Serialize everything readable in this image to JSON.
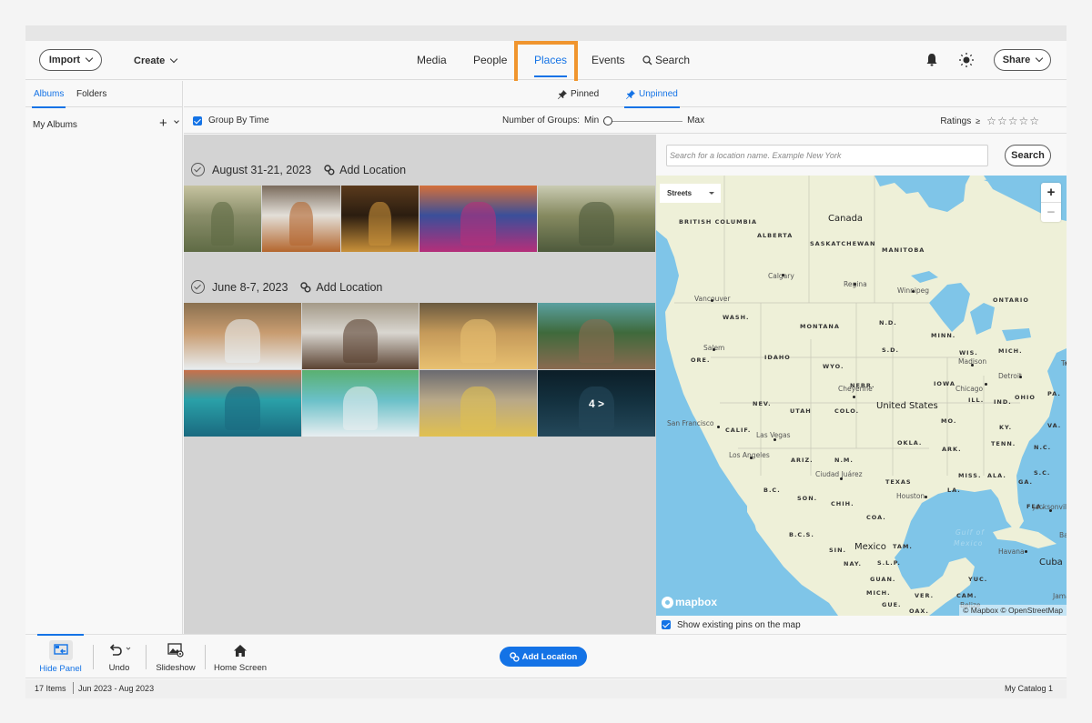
{
  "topbar": {
    "import_label": "Import",
    "create_label": "Create",
    "nav": [
      {
        "label": "Media",
        "active": false
      },
      {
        "label": "People",
        "active": false
      },
      {
        "label": "Places",
        "active": true
      },
      {
        "label": "Events",
        "active": false
      },
      {
        "label": "Search",
        "active": false
      }
    ],
    "share_label": "Share",
    "icons": [
      "bell-icon",
      "brightness-icon"
    ]
  },
  "sidebar": {
    "tabs": [
      {
        "label": "Albums",
        "active": true
      },
      {
        "label": "Folders",
        "active": false
      }
    ],
    "my_albums_label": "My Albums"
  },
  "subbar": {
    "tabs": [
      {
        "label": "Pinned",
        "active": false
      },
      {
        "label": "Unpinned",
        "active": true
      }
    ]
  },
  "filterbar": {
    "group_by_time_label": "Group By Time",
    "group_by_time_checked": true,
    "number_of_groups_label": "Number of Groups:",
    "min_label": "Min",
    "max_label": "Max",
    "groups_slider_value": 0,
    "ratings_label": "Ratings",
    "ratings_operator": "≥",
    "ratings_stars": 0,
    "ratings_max": 5
  },
  "groups": [
    {
      "date": "August 31-21, 2023",
      "add_location_label": "Add Location",
      "photos": [
        {
          "desc": "Hikers walking through a grassy valley",
          "colors": [
            "#8a8e6a",
            "#5f6b45",
            "#c6c3a0"
          ]
        },
        {
          "desc": "Person dancing on a couch in a living room",
          "colors": [
            "#e3dfd8",
            "#b4662e",
            "#7a6b5c"
          ]
        },
        {
          "desc": "Hand reaching toward string lights at night",
          "colors": [
            "#2b1d10",
            "#c9913a",
            "#5a3a1c"
          ]
        },
        {
          "desc": "Collage of people in neon colored lighting",
          "colors": [
            "#3a4f9a",
            "#b52f7a",
            "#d4703a"
          ]
        },
        {
          "desc": "Hikers in a mountain meadow",
          "colors": [
            "#868a60",
            "#4e5a3c",
            "#c9cbb2"
          ]
        }
      ]
    },
    {
      "date": "June 8-7, 2023",
      "add_location_label": "Add Location",
      "photos": [
        {
          "desc": "Couple walking on a dirt road",
          "colors": [
            "#c89c70",
            "#e8ecee",
            "#8a7050"
          ]
        },
        {
          "desc": "Couple smiling from a car window",
          "colors": [
            "#d9d6d0",
            "#5b4332",
            "#a49a88"
          ]
        },
        {
          "desc": "Couple taking a selfie in a field",
          "colors": [
            "#c59a5a",
            "#e8c070",
            "#6a5a40"
          ]
        },
        {
          "desc": "Couple relaxing on a longtail boat",
          "colors": [
            "#3f6a3c",
            "#8a6a50",
            "#5aa0a0"
          ]
        },
        {
          "desc": "Snorkelers taking an underwater selfie",
          "colors": [
            "#2aa0a8",
            "#1a6a80",
            "#c8704a"
          ]
        },
        {
          "desc": "Couple kayaking in turquoise water",
          "colors": [
            "#6ac0c8",
            "#e8eef0",
            "#5ab070"
          ]
        },
        {
          "desc": "Couple walking on a pier by boats",
          "colors": [
            "#b8a888",
            "#e0c050",
            "#6a6a70"
          ]
        },
        {
          "desc": "Divers swimming in dark water",
          "colors": [
            "#13303e",
            "#24485a",
            "#0c1e28"
          ],
          "more_label": "4 >"
        }
      ]
    }
  ],
  "map_panel": {
    "search_placeholder": "Search for a location name. Example New York",
    "search_value": "",
    "search_button_label": "Search",
    "style_dropdown_value": "Streets",
    "zoom_in_label": "+",
    "zoom_out_label": "−",
    "mapbox_label": "mapbox",
    "attribution": "© Mapbox © OpenStreetMap",
    "show_pins_label": "Show existing pins on the map",
    "show_pins_checked": true,
    "labels": {
      "countries": [
        "Canada",
        "United States",
        "Mexico",
        "Cuba"
      ],
      "regions": [
        "BRITISH COLUMBIA",
        "ALBERTA",
        "SASKATCHEWAN",
        "MANITOBA",
        "ONTARIO",
        "WASH.",
        "MONTANA",
        "N.D.",
        "MINN.",
        "ORE.",
        "IDAHO",
        "WYO.",
        "S.D.",
        "WIS.",
        "MICH.",
        "NEBR.",
        "IOWA",
        "NEV.",
        "UTAH",
        "COLO.",
        "ILL.",
        "IND.",
        "OHIO",
        "PA.",
        "CALIF.",
        "MO.",
        "KY.",
        "VA.",
        "OKLA.",
        "ARK.",
        "TENN.",
        "N.C.",
        "ARIZ.",
        "N.M.",
        "S.C.",
        "TEXAS",
        "MISS.",
        "ALA.",
        "GA.",
        "LA.",
        "FLA.",
        "B.C.",
        "SON.",
        "CHIH.",
        "COA.",
        "B.C.S.",
        "SIN.",
        "TAM.",
        "NAY.",
        "S.L.P.",
        "GUAN.",
        "YUC.",
        "MICH.",
        "VER.",
        "CAM.",
        "GUE.",
        "OAX."
      ],
      "cities": [
        "Calgary",
        "Regina",
        "Winnipeg",
        "Vancouver",
        "Salem",
        "Madison",
        "Detroit",
        "Toronto",
        "Cheyenne",
        "Chicago",
        "San Francisco",
        "Las Vegas",
        "Los Angeles",
        "Ciudad Juárez",
        "Houston",
        "Jacksonville",
        "Havana",
        "Belize",
        "Jamaica",
        "Bahamas"
      ],
      "seas": [
        "Gulf of",
        "Mexico"
      ]
    }
  },
  "bottombar": {
    "tools": [
      {
        "label": "Hide Panel",
        "icon": "hide-panel-icon",
        "active": true
      },
      {
        "label": "Undo",
        "icon": "undo-icon",
        "active": false
      },
      {
        "label": "Slideshow",
        "icon": "slideshow-icon",
        "active": false
      },
      {
        "label": "Home Screen",
        "icon": "home-icon",
        "active": false
      }
    ],
    "add_location_label": "Add Location"
  },
  "statusbar": {
    "items_count": "17 Items",
    "date_range": "Jun 2023 - Aug 2023",
    "catalog": "My Catalog 1"
  },
  "colors": {
    "accent": "#1473e6",
    "highlight": "#f0952e",
    "grid_bg": "#d3d3d3",
    "water": "#7fc5e8",
    "land": "#eef0d8"
  }
}
